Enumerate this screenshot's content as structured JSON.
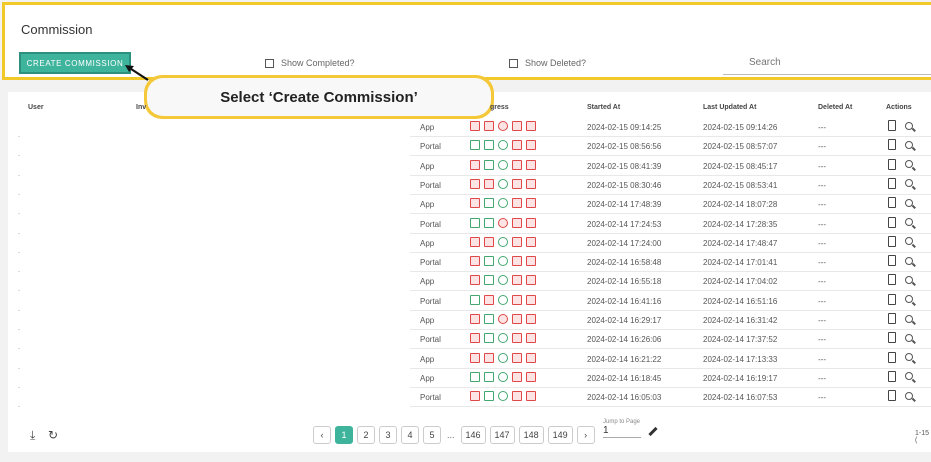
{
  "header": {
    "title": "Commission",
    "create_label": "CREATE COMMISSION",
    "show_completed": "Show Completed?",
    "show_deleted": "Show Deleted?",
    "search_placeholder": "Search"
  },
  "callout": {
    "text": "Select ‘Create Commission’"
  },
  "table": {
    "columns": {
      "user": "User",
      "inv": "Inv",
      "progress": "gress",
      "started": "Started At",
      "updated": "Last Updated At",
      "deleted": "Deleted At",
      "actions": "Actions"
    },
    "rows": [
      {
        "source": "App",
        "started": "2024-02-15 09:14:25",
        "updated": "2024-02-15 09:14:26",
        "deleted": "---"
      },
      {
        "source": "Portal",
        "started": "2024-02-15 08:56:56",
        "updated": "2024-02-15 08:57:07",
        "deleted": "---"
      },
      {
        "source": "App",
        "started": "2024-02-15 08:41:39",
        "updated": "2024-02-15 08:45:17",
        "deleted": "---"
      },
      {
        "source": "Portal",
        "started": "2024-02-15 08:30:46",
        "updated": "2024-02-15 08:53:41",
        "deleted": "---"
      },
      {
        "source": "App",
        "started": "2024-02-14 17:48:39",
        "updated": "2024-02-14 18:07:28",
        "deleted": "---"
      },
      {
        "source": "Portal",
        "started": "2024-02-14 17:24:53",
        "updated": "2024-02-14 17:28:35",
        "deleted": "---"
      },
      {
        "source": "App",
        "started": "2024-02-14 17:24:00",
        "updated": "2024-02-14 17:48:47",
        "deleted": "---"
      },
      {
        "source": "Portal",
        "started": "2024-02-14 16:58:48",
        "updated": "2024-02-14 17:01:41",
        "deleted": "---"
      },
      {
        "source": "App",
        "started": "2024-02-14 16:55:18",
        "updated": "2024-02-14 17:04:02",
        "deleted": "---"
      },
      {
        "source": "Portal",
        "started": "2024-02-14 16:41:16",
        "updated": "2024-02-14 16:51:16",
        "deleted": "---"
      },
      {
        "source": "App",
        "started": "2024-02-14 16:29:17",
        "updated": "2024-02-14 16:31:42",
        "deleted": "---"
      },
      {
        "source": "Portal",
        "started": "2024-02-14 16:26:06",
        "updated": "2024-02-14 17:37:52",
        "deleted": "---"
      },
      {
        "source": "App",
        "started": "2024-02-14 16:21:22",
        "updated": "2024-02-14 17:13:33",
        "deleted": "---"
      },
      {
        "source": "App",
        "started": "2024-02-14 16:18:45",
        "updated": "2024-02-14 16:19:17",
        "deleted": "---"
      },
      {
        "source": "Portal",
        "started": "2024-02-14 16:05:03",
        "updated": "2024-02-14 16:07:53",
        "deleted": "---"
      }
    ]
  },
  "pager": {
    "pages": [
      "1",
      "2",
      "3",
      "4",
      "5"
    ],
    "ellipsis": "...",
    "tail_pages": [
      "146",
      "147",
      "148",
      "149"
    ],
    "active": "1",
    "jump_label": "Jump to Page",
    "jump_value": "1",
    "range": "1-15 ("
  }
}
